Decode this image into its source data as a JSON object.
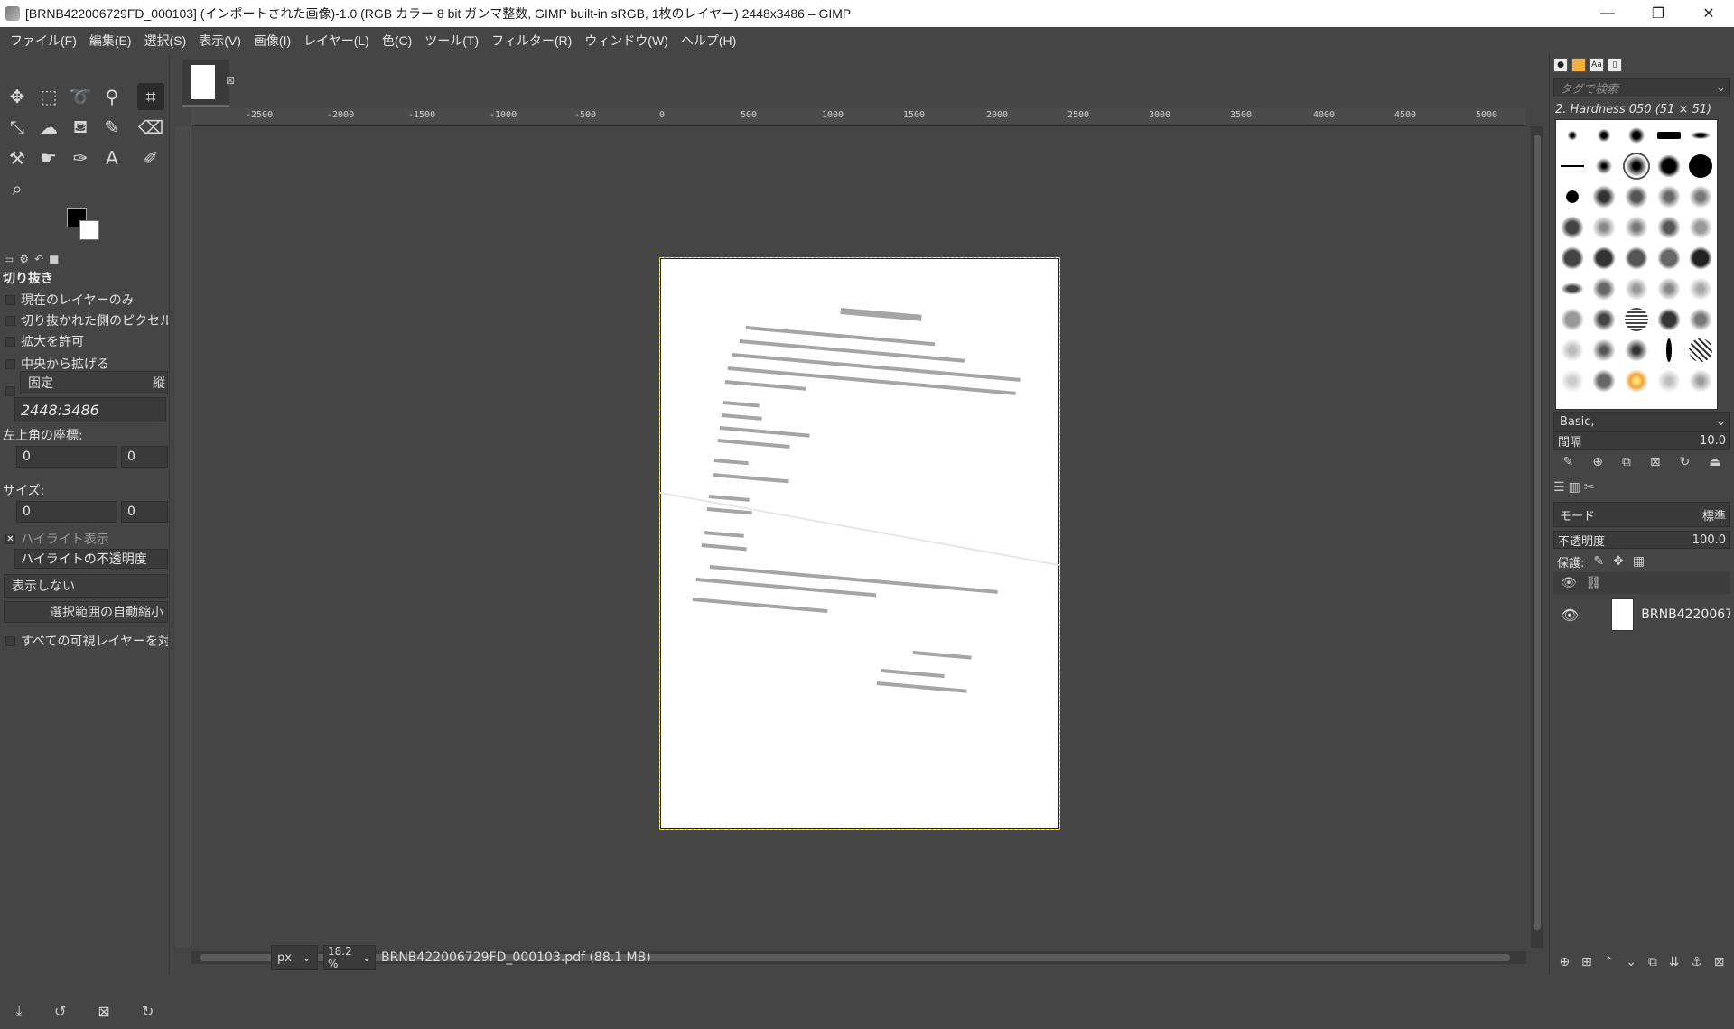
{
  "window": {
    "title": "[BRNB422006729FD_000103] (インポートされた画像)-1.0 (RGB カラー 8 bit ガンマ整数, GIMP built-in sRGB, 1枚のレイヤー) 2448x3486 – GIMP",
    "controls": [
      "—",
      "❐",
      "✕"
    ]
  },
  "menu": [
    "ファイル(F)",
    "編集(E)",
    "選択(S)",
    "表示(V)",
    "画像(I)",
    "レイヤー(L)",
    "色(C)",
    "ツール(T)",
    "フィルター(R)",
    "ウィンドウ(W)",
    "ヘルプ(H)"
  ],
  "tool_options": {
    "title": "切り抜き",
    "current_layer_only": "現在のレイヤーのみ",
    "delete_cropped": "切り抜かれた側のピクセル",
    "allow_growing": "拡大を許可",
    "expand_center": "中央から拡げる",
    "fixed_label": "固定",
    "fixed_mode_suffix": "縦",
    "aspect_value": "2448:3486",
    "position_label": "左上角の座標:",
    "pos_x": "0",
    "pos_y": "0",
    "size_label": "サイズ:",
    "size_w": "0",
    "size_h": "0",
    "highlight": "ハイライト表示",
    "highlight_opacity": "ハイライトの不透明度",
    "guides": "表示しない",
    "auto_shrink": "選択範囲の自動縮小",
    "shrink_merged": "すべての可視レイヤーを対"
  },
  "ruler": {
    "ticks": [
      "-2500",
      "-2000",
      "-1500",
      "-1000",
      "-500",
      "0",
      "500",
      "1000",
      "1500",
      "2000",
      "2500",
      "3000",
      "3500",
      "4000",
      "4500",
      "5000"
    ]
  },
  "status": {
    "unit": "px",
    "zoom": "18.2 %",
    "file": "BRNB422006729FD_000103.pdf (88.1 MB)"
  },
  "brushes": {
    "search_placeholder": "タグで検索",
    "selected": "2. Hardness 050 (51 × 51)",
    "preset": "Basic,",
    "spacing_label": "間隔",
    "spacing_value": "10.0"
  },
  "layers": {
    "mode_label": "モード",
    "mode_value": "標準",
    "opacity_label": "不透明度",
    "opacity_value": "100.0",
    "lock_label": "保護:",
    "layer_name": "BRNB4220067"
  }
}
